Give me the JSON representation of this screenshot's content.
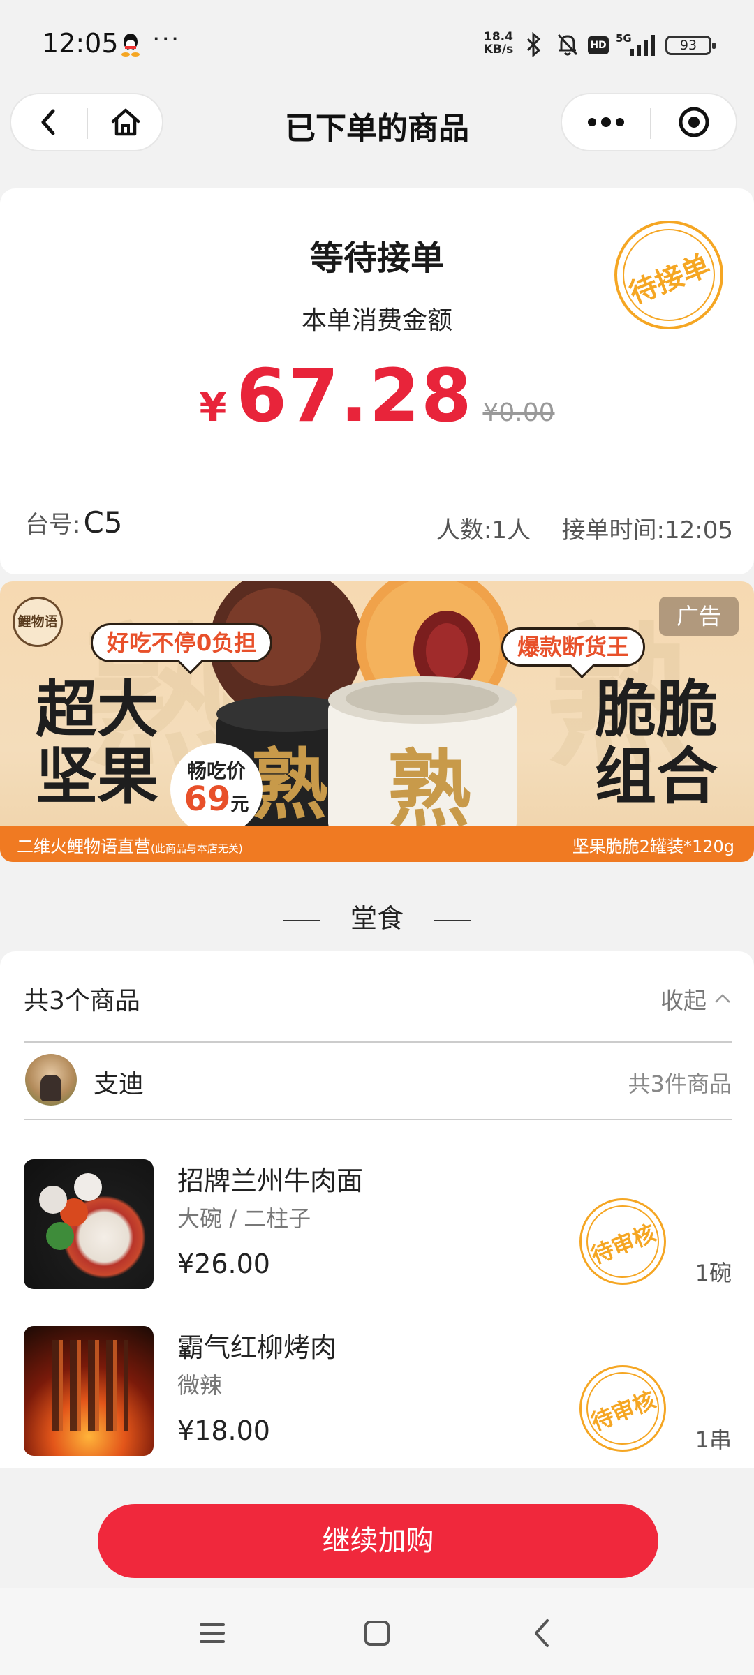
{
  "status_bar": {
    "time": "12:05",
    "more": "···",
    "net_speed_value": "18.4",
    "net_speed_unit": "KB/s",
    "network_label": "5G",
    "hd_label": "HD",
    "battery": "93",
    "icons": [
      "qq-icon",
      "bluetooth-icon",
      "bell-off-icon",
      "hd-icon",
      "signal-icon",
      "battery-icon"
    ]
  },
  "nav": {
    "title": "已下单的商品",
    "icons": [
      "back-icon",
      "home-icon",
      "more-icon",
      "target-icon"
    ]
  },
  "order": {
    "status": "等待接单",
    "stamp": "待接单",
    "amount_label": "本单消费金额",
    "currency": "¥",
    "amount": "67.28",
    "original_price": "¥0.00",
    "table_label": "台号:",
    "table_no": "C5",
    "people": "人数:1人",
    "accept_time": "接单时间:12:05"
  },
  "ad": {
    "tag": "广告",
    "logo_text": "鲤物语",
    "bubble_left": "好吃不停0负担",
    "bubble_right": "爆款断货王",
    "big_left": "超大\n坚果",
    "big_right": "脆脆\n组合",
    "price_label": "畅吃价",
    "price_value": "69",
    "price_unit": "元",
    "can_label_1": "熟",
    "can_label_2": "熟",
    "bottom_left": "二维火鲤物语直营",
    "bottom_left_note": "(此商品与本店无关)",
    "bottom_right": "坚果脆脆2罐装*120g"
  },
  "section": {
    "title": "堂食"
  },
  "items_card": {
    "count": "共3个商品",
    "collapse": "收起",
    "user": {
      "name": "支迪",
      "count": "共3件商品"
    },
    "items": [
      {
        "name": "招牌兰州牛肉面",
        "spec": "大碗 / 二柱子",
        "price": "¥26.00",
        "stamp": "待审核",
        "qty": "1碗"
      },
      {
        "name": "霸气红柳烤肉",
        "spec": "微辣",
        "price": "¥18.00",
        "stamp": "待审核",
        "qty": "1串"
      }
    ]
  },
  "footer": {
    "continue": "继续加购"
  },
  "colors": {
    "accent_red": "#f0283c",
    "price_red": "#e8243a",
    "stamp_orange": "#f5a623",
    "ad_orange": "#f07a22"
  }
}
